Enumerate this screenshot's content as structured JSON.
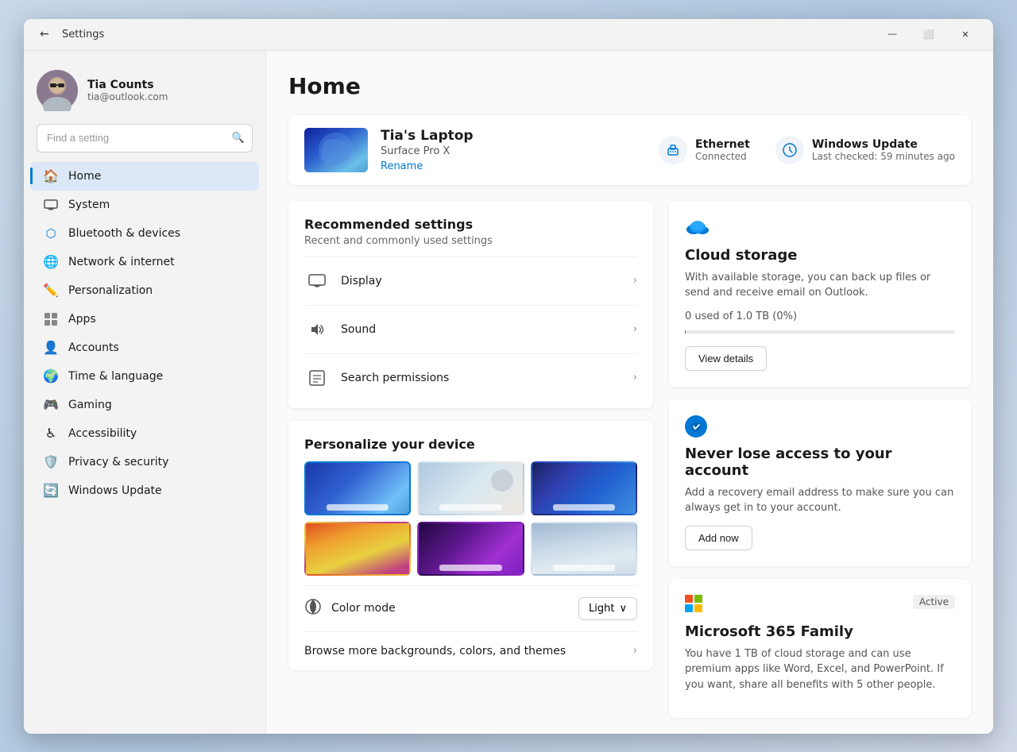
{
  "window": {
    "title": "Settings",
    "back_label": "←",
    "minimize": "—",
    "maximize": "⬜",
    "close": "✕"
  },
  "sidebar": {
    "profile": {
      "name": "Tia Counts",
      "email": "tia@outlook.com",
      "avatar_emoji": "👩"
    },
    "search_placeholder": "Find a setting",
    "nav_items": [
      {
        "id": "home",
        "label": "Home",
        "icon": "🏠",
        "active": true
      },
      {
        "id": "system",
        "label": "System",
        "icon": "💻"
      },
      {
        "id": "bluetooth",
        "label": "Bluetooth & devices",
        "icon": "🔵"
      },
      {
        "id": "network",
        "label": "Network & internet",
        "icon": "🌐"
      },
      {
        "id": "personalization",
        "label": "Personalization",
        "icon": "✏️"
      },
      {
        "id": "apps",
        "label": "Apps",
        "icon": "🔲"
      },
      {
        "id": "accounts",
        "label": "Accounts",
        "icon": "👤"
      },
      {
        "id": "time",
        "label": "Time & language",
        "icon": "🌍"
      },
      {
        "id": "gaming",
        "label": "Gaming",
        "icon": "🎮"
      },
      {
        "id": "accessibility",
        "label": "Accessibility",
        "icon": "♿"
      },
      {
        "id": "privacy",
        "label": "Privacy & security",
        "icon": "🛡️"
      },
      {
        "id": "update",
        "label": "Windows Update",
        "icon": "🔄"
      }
    ]
  },
  "main": {
    "page_title": "Home",
    "device": {
      "name": "Tia's Laptop",
      "model": "Surface Pro X",
      "rename_label": "Rename",
      "ethernet_label": "Ethernet",
      "ethernet_sub": "Connected",
      "update_label": "Windows Update",
      "update_sub": "Last checked: 59 minutes ago"
    },
    "recommended": {
      "title": "Recommended settings",
      "subtitle": "Recent and commonly used settings",
      "rows": [
        {
          "id": "display",
          "label": "Display",
          "icon": "🖥️"
        },
        {
          "id": "sound",
          "label": "Sound",
          "icon": "🔊"
        },
        {
          "id": "search-perm",
          "label": "Search permissions",
          "icon": "📅"
        }
      ]
    },
    "personalize": {
      "title": "Personalize your device",
      "color_mode_label": "Color mode",
      "color_mode_value": "Light",
      "browse_label": "Browse more backgrounds, colors, and themes"
    }
  },
  "right": {
    "cloud": {
      "title": "Cloud storage",
      "desc": "With available storage, you can back up files or send and receive email on Outlook.",
      "used": "0 used of 1.0 TB (0%)",
      "btn_label": "View details"
    },
    "account": {
      "title": "Never lose access to your account",
      "desc": "Add a recovery email address to make sure you can always get in to your account.",
      "btn_label": "Add now"
    },
    "m365": {
      "title": "Microsoft 365 Family",
      "active_label": "Active",
      "desc": "You have 1 TB of cloud storage and can use premium apps like Word, Excel, and PowerPoint. If you want, share all benefits with 5 other people."
    }
  }
}
